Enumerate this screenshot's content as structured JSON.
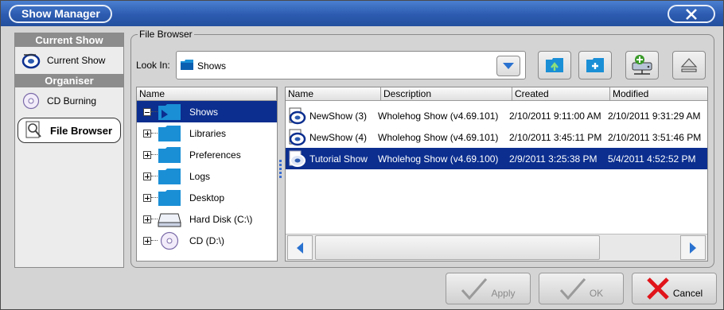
{
  "window": {
    "title": "Show Manager"
  },
  "sidebar": {
    "sections": [
      {
        "header": "Current Show",
        "items": [
          {
            "label": "Current Show",
            "icon": "show-disc-icon"
          }
        ]
      },
      {
        "header": "Organiser",
        "items": [
          {
            "label": "CD Burning",
            "icon": "cd-icon"
          },
          {
            "label": "File Browser",
            "icon": "magnifier-icon",
            "active": true
          }
        ]
      }
    ]
  },
  "file_browser": {
    "legend": "File Browser",
    "look_in_label": "Look In:",
    "look_in_value": "Shows",
    "tree_header": "Name",
    "tree": [
      {
        "label": "Shows",
        "icon": "folder-icon",
        "selected": true,
        "expanded": true
      },
      {
        "label": "Libraries",
        "icon": "folder-icon"
      },
      {
        "label": "Preferences",
        "icon": "folder-icon"
      },
      {
        "label": "Logs",
        "icon": "folder-icon"
      },
      {
        "label": "Desktop",
        "icon": "folder-icon"
      },
      {
        "label": "Hard Disk (C:\\)",
        "icon": "hard-disk-icon"
      },
      {
        "label": "CD (D:\\)",
        "icon": "cd-icon"
      }
    ],
    "columns": [
      "Name",
      "Description",
      "Created",
      "Modified"
    ],
    "rows": [
      {
        "name": "NewShow (3)",
        "description": "Wholehog Show (v4.69.101)",
        "created": "2/10/2011 9:11:00 AM",
        "modified": "2/10/2011 9:31:29 AM"
      },
      {
        "name": "NewShow (4)",
        "description": "Wholehog Show (v4.69.101)",
        "created": "2/10/2011 3:45:11 PM",
        "modified": "2/10/2011 3:51:46 PM"
      },
      {
        "name": "Tutorial Show",
        "description": "Wholehog Show (v4.69.100)",
        "created": "2/9/2011 3:25:38 PM",
        "modified": "5/4/2011 4:52:52 PM",
        "selected": true
      }
    ]
  },
  "buttons": {
    "apply": "Apply",
    "ok": "OK",
    "cancel": "Cancel"
  },
  "colors": {
    "titlebar": "#2c5bb0",
    "selection": "#0b2e8f",
    "folder": "#1a8fd6",
    "cancel_x": "#e0141a"
  }
}
